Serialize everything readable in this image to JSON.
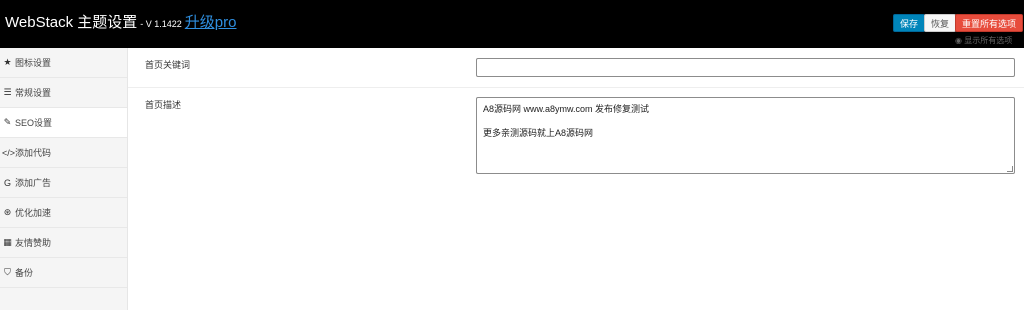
{
  "header": {
    "app_name": "WebStack 主题设置",
    "version": "- V 1.1422",
    "pro_link": "升级pro",
    "save_label": "保存",
    "restore_label": "恢复",
    "reset_label": "重置所有选项",
    "show_all": "显示所有选项",
    "colors": {
      "save": "#0085ba",
      "reset": "#e74c3c",
      "background": "#000000"
    }
  },
  "sidebar": {
    "items": [
      {
        "label": "图标设置",
        "icon": "star-icon",
        "glyph": "★"
      },
      {
        "label": "常规设置",
        "icon": "list-icon",
        "glyph": "☰"
      },
      {
        "label": "SEO设置",
        "icon": "pencil-icon",
        "glyph": "✎"
      },
      {
        "label": "添加代码",
        "icon": "code-icon",
        "glyph": "</>"
      },
      {
        "label": "添加广告",
        "icon": "google-icon",
        "glyph": "G"
      },
      {
        "label": "优化加速",
        "icon": "wordpress-icon",
        "glyph": "⊛"
      },
      {
        "label": "友情赞助",
        "icon": "grid-icon",
        "glyph": "▦"
      },
      {
        "label": "备份",
        "icon": "shield-icon",
        "glyph": "⛉"
      }
    ],
    "active_index": 2
  },
  "main": {
    "keywords": {
      "label": "首页关键词",
      "value": ""
    },
    "description": {
      "label": "首页描述",
      "line1": "A8源码网 www.a8ymw.com 发布修复测试",
      "line2": "更多亲测源码就上A8源码网"
    }
  }
}
